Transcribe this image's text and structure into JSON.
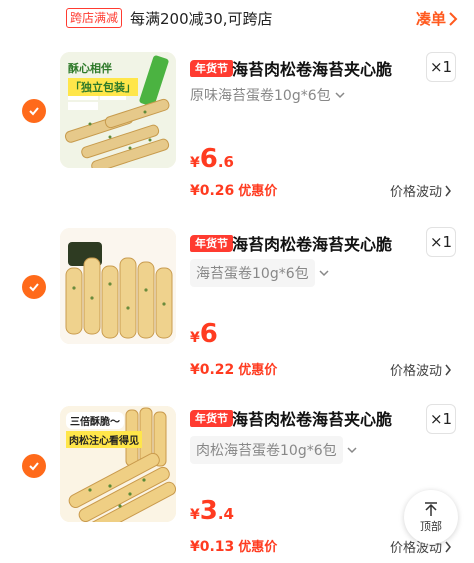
{
  "promo": {
    "tag": "跨店满减",
    "text": "每满200减30,可跨店",
    "link": "凑单",
    "link_icon": "chevron-right"
  },
  "items": [
    {
      "checked": true,
      "tag": "年货节",
      "title": "海苔肉松卷海苔夹心脆",
      "qty": "×1",
      "spec": "原味海苔蛋卷10g*6包",
      "price_currency": "¥",
      "price_int": "6",
      "price_dec": ".6",
      "promo_price": "¥0.26",
      "promo_label": "优惠价",
      "trend": "价格波动",
      "image_text": [
        "酥心相伴",
        "「独立包装」"
      ]
    },
    {
      "checked": true,
      "tag": "年货节",
      "title": "海苔肉松卷海苔夹心脆",
      "qty": "×1",
      "spec": "海苔蛋卷10g*6包",
      "price_currency": "¥",
      "price_int": "6",
      "price_dec": "",
      "promo_price": "¥0.22",
      "promo_label": "优惠价",
      "trend": "价格波动"
    },
    {
      "checked": true,
      "tag": "年货节",
      "title": "海苔肉松卷海苔夹心脆",
      "qty": "×1",
      "spec": "肉松海苔蛋卷10g*6包",
      "price_currency": "¥",
      "price_int": "3",
      "price_dec": ".4",
      "promo_price": "¥0.13",
      "promo_label": "优惠价",
      "trend": "价格波动",
      "image_text": [
        "三倍酥脆～",
        "肉松注心看得见"
      ]
    }
  ],
  "back_to_top": "顶部",
  "colors": {
    "accent": "#ff6a1a",
    "price": "#ff3b20",
    "tag": "#ff3b30"
  }
}
